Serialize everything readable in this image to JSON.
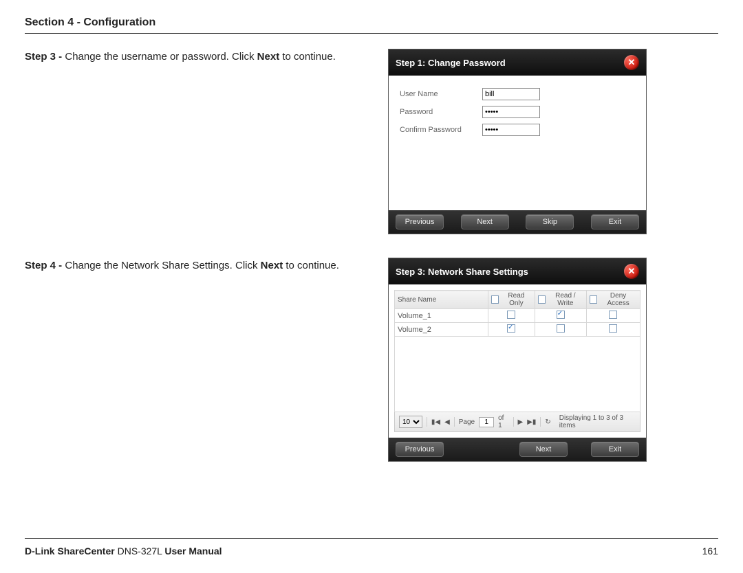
{
  "section_header": "Section 4 - Configuration",
  "step3": {
    "prefix": "Step 3 - ",
    "text_a": "Change the username or password. Click ",
    "next": "Next",
    "text_b": " to continue."
  },
  "step4": {
    "prefix": "Step 4 - ",
    "text_a": "Change the Network Share Settings. Click ",
    "next": "Next",
    "text_b": " to continue."
  },
  "panel1": {
    "title": "Step 1: Change Password",
    "labels": {
      "username": "User Name",
      "password": "Password",
      "confirm": "Confirm Password"
    },
    "values": {
      "username": "bill",
      "password": "•••••",
      "confirm": "•••••"
    },
    "buttons": {
      "previous": "Previous",
      "next": "Next",
      "skip": "Skip",
      "exit": "Exit"
    }
  },
  "panel2": {
    "title": "Step 3: Network Share Settings",
    "columns": {
      "share": "Share Name",
      "ro": "Read Only",
      "rw": "Read / Write",
      "deny": "Deny Access"
    },
    "rows": [
      {
        "name": "Volume_1",
        "ro": false,
        "rw": true,
        "deny": false
      },
      {
        "name": "Volume_2",
        "ro": true,
        "rw": false,
        "deny": false
      }
    ],
    "pager": {
      "pagesize": "10",
      "label_page": "Page",
      "page": "1",
      "label_of": "of 1",
      "status": "Displaying 1 to 3 of 3 items"
    },
    "buttons": {
      "previous": "Previous",
      "next": "Next",
      "exit": "Exit"
    }
  },
  "footer": {
    "brand_bold1": "D-Link ShareCenter",
    "model": " DNS-327L ",
    "brand_bold2": "User Manual",
    "page": "161"
  }
}
